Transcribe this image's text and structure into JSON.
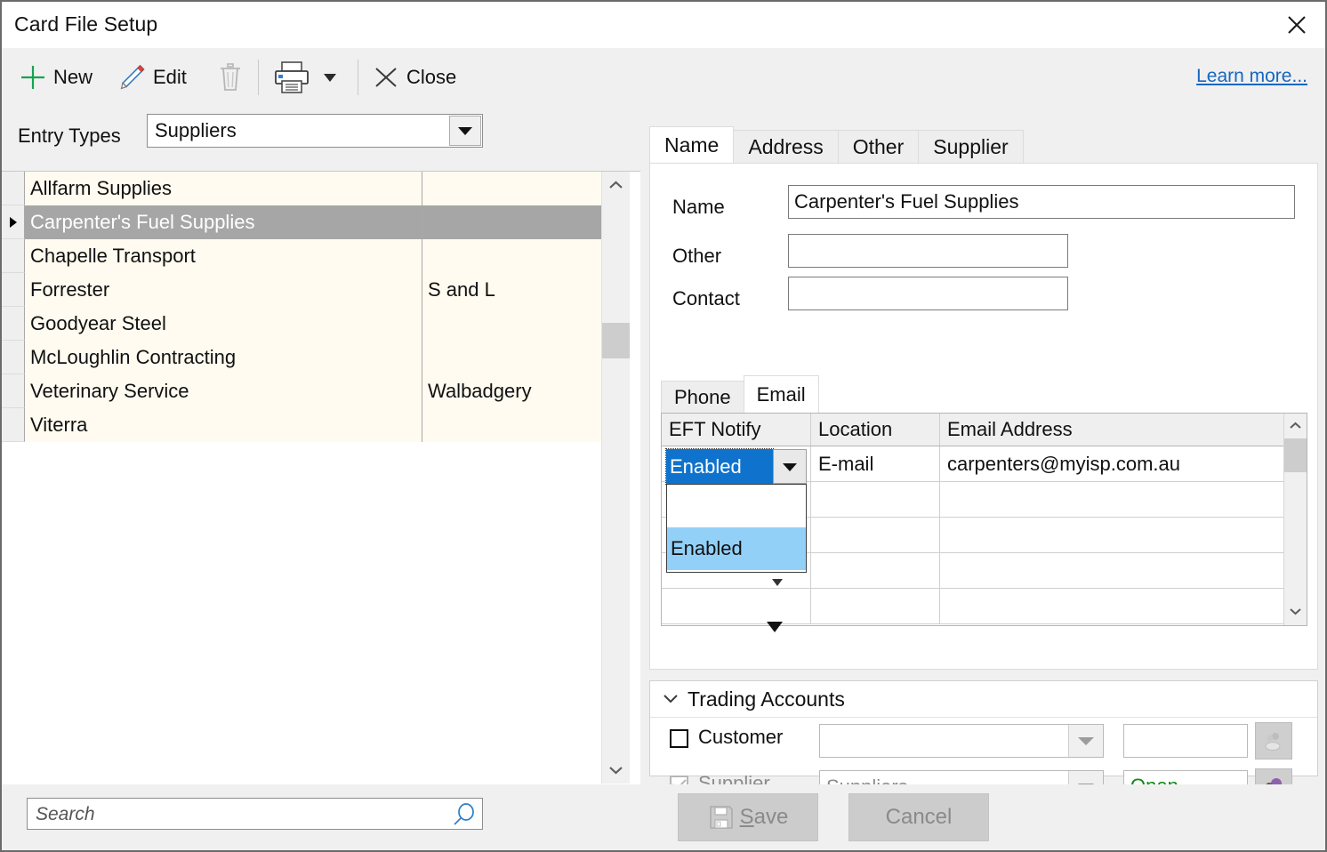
{
  "window": {
    "title": "Card File Setup",
    "close_icon": "close-icon"
  },
  "toolbar": {
    "new_label": "New",
    "edit_label": "Edit",
    "delete_icon": "trash-icon",
    "print_icon": "printer-icon",
    "print_dropdown_icon": "chevron-down-icon",
    "close_label": "Close",
    "learn_more_label": "Learn more..."
  },
  "entry_types": {
    "label": "Entry Types",
    "value": "Suppliers",
    "dropdown_icon": "chevron-down-icon"
  },
  "list": {
    "selected_index": 1,
    "rows": [
      {
        "name": "Allfarm Supplies",
        "other": ""
      },
      {
        "name": "Carpenter's Fuel Supplies",
        "other": ""
      },
      {
        "name": "Chapelle Transport",
        "other": ""
      },
      {
        "name": "Forrester",
        "other": "S and L"
      },
      {
        "name": "Goodyear Steel",
        "other": ""
      },
      {
        "name": "McLoughlin Contracting",
        "other": ""
      },
      {
        "name": "Veterinary Service",
        "other": "Walbadgery"
      },
      {
        "name": "Viterra",
        "other": ""
      }
    ]
  },
  "search": {
    "placeholder": "Search",
    "value": "",
    "icon": "search-icon"
  },
  "tabs": {
    "active": "Name",
    "items": [
      {
        "label": "Name"
      },
      {
        "label": "Address"
      },
      {
        "label": "Other"
      },
      {
        "label": "Supplier"
      }
    ]
  },
  "name_tab": {
    "fields": [
      {
        "label": "Name",
        "value": "Carpenter's Fuel Supplies"
      },
      {
        "label": "Other",
        "value": ""
      },
      {
        "label": "Contact",
        "value": ""
      }
    ]
  },
  "contact_tabs": {
    "active": "Email",
    "items": [
      {
        "label": "Phone"
      },
      {
        "label": "Email"
      }
    ]
  },
  "email_grid": {
    "columns": [
      "EFT Notify",
      "Location",
      "Email Address"
    ],
    "rows": [
      {
        "eft_notify": "Enabled",
        "location": "E-mail",
        "email": "carpenters@myisp.com.au"
      },
      {
        "eft_notify": "",
        "location": "",
        "email": ""
      },
      {
        "eft_notify": "",
        "location": "",
        "email": ""
      },
      {
        "eft_notify": "",
        "location": "",
        "email": ""
      },
      {
        "eft_notify": "",
        "location": "",
        "email": ""
      }
    ],
    "open_dropdown": {
      "selected_value": "Enabled",
      "options": [
        "",
        "Enabled"
      ],
      "highlighted_option": "Enabled",
      "selected_bg": "#0f73cd",
      "highlight_bg": "#93d0f7"
    }
  },
  "trading_accounts": {
    "title": "Trading Accounts",
    "expand_icon": "chevron-down-icon",
    "customer": {
      "label": "Customer",
      "checked": false,
      "combo_value": "",
      "text_value": "",
      "button_icon": "contacts-icon"
    },
    "supplier": {
      "label": "Supplier",
      "checked": true,
      "disabled": true,
      "combo_value": "Suppliers",
      "text_value": "Open",
      "text_color": "#0b8a17",
      "button_icon": "contacts-icon"
    }
  },
  "actions": {
    "save_label": "Save",
    "save_accel": "S",
    "save_icon": "save-disk-icon",
    "cancel_label": "Cancel"
  }
}
